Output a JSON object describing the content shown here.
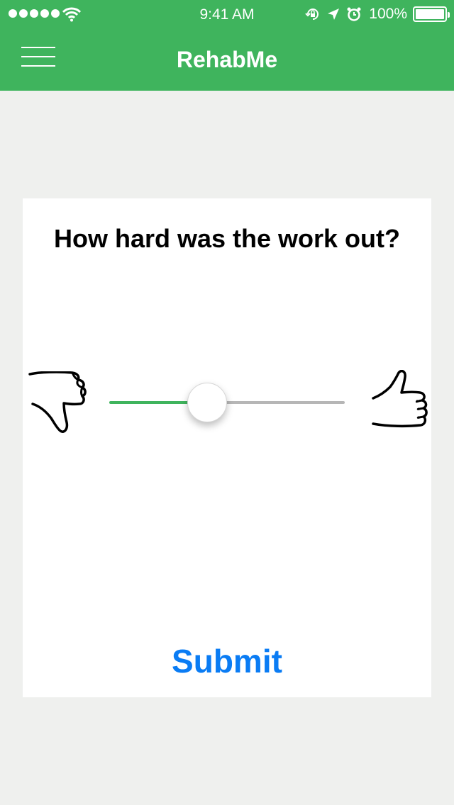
{
  "status_bar": {
    "time": "9:41 AM",
    "battery_percent": "100%",
    "icons": [
      "signal-dots-icon",
      "wifi-icon",
      "orientation-lock-icon",
      "location-icon",
      "alarm-icon",
      "battery-icon"
    ]
  },
  "nav": {
    "title": "RehabMe",
    "menu_icon": "hamburger-menu-icon"
  },
  "card": {
    "question": "How hard was the work out?",
    "slider": {
      "value": 0.4,
      "min_icon": "thumbs-down-icon",
      "max_icon": "thumbs-up-icon"
    },
    "submit_label": "Submit"
  },
  "colors": {
    "brand_green": "#3fb45d",
    "submit_blue": "#0a7cf4",
    "background": "#eff0ee",
    "track_inactive": "#b6b6b6"
  }
}
